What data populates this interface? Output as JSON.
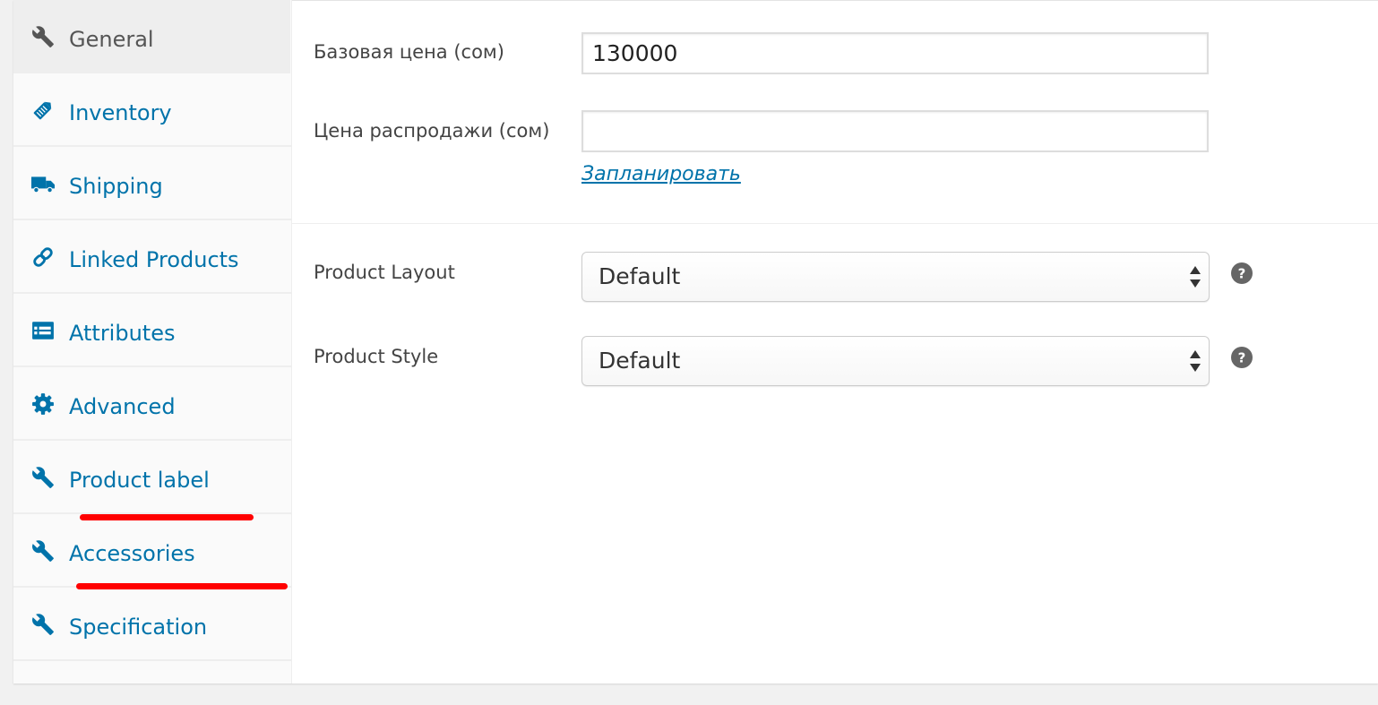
{
  "tabs": [
    {
      "label": "General",
      "icon": "wrench-icon",
      "active": true
    },
    {
      "label": "Inventory",
      "icon": "tag-icon",
      "active": false
    },
    {
      "label": "Shipping",
      "icon": "truck-icon",
      "active": false
    },
    {
      "label": "Linked Products",
      "icon": "link-icon",
      "active": false
    },
    {
      "label": "Attributes",
      "icon": "list-icon",
      "active": false
    },
    {
      "label": "Advanced",
      "icon": "gear-icon",
      "active": false
    },
    {
      "label": "Product label",
      "icon": "wrench-icon",
      "active": false
    },
    {
      "label": "Accessories",
      "icon": "wrench-icon",
      "active": false
    },
    {
      "label": "Specification",
      "icon": "wrench-icon",
      "active": false
    }
  ],
  "pricing": {
    "regular_label": "Базовая цена (сом)",
    "regular_value": "130000",
    "sale_label": "Цена распродажи (сом)",
    "sale_value": "",
    "schedule_link": "Запланировать"
  },
  "layout": {
    "product_layout_label": "Product Layout",
    "product_layout_value": "Default",
    "product_style_label": "Product Style",
    "product_style_value": "Default"
  },
  "colors": {
    "link": "#0073aa",
    "active_tab_text": "#555555",
    "annotation": "#ff0000"
  }
}
